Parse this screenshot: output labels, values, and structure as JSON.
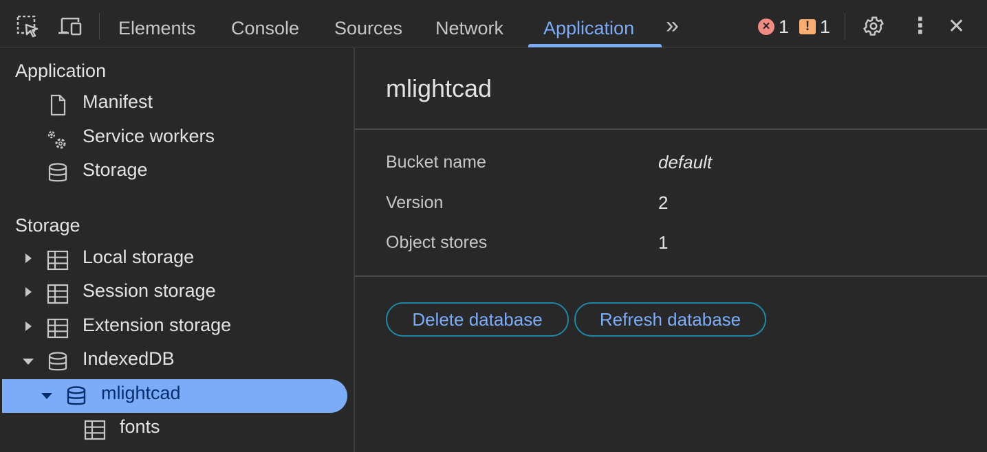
{
  "toolbar": {
    "tabs": [
      "Elements",
      "Console",
      "Sources",
      "Network",
      "Application"
    ],
    "active_tab": "Application",
    "error_count": "1",
    "warning_count": "1",
    "error_icon_glyph": "×",
    "warning_icon_glyph": "!",
    "more_tabs_glyph": "»",
    "close_glyph": "✕",
    "menu_glyph": "⋮"
  },
  "sidebar": {
    "application_section": {
      "title": "Application",
      "items": [
        "Manifest",
        "Service workers",
        "Storage"
      ]
    },
    "storage_section": {
      "title": "Storage",
      "items": [
        "Local storage",
        "Session storage",
        "Extension storage",
        "IndexedDB"
      ],
      "indexeddb_children": {
        "database": "mlightcad",
        "stores": [
          "fonts"
        ]
      }
    }
  },
  "main": {
    "database_name": "mlightcad",
    "details": [
      {
        "key": "Bucket name",
        "value": "default"
      },
      {
        "key": "Version",
        "value": "2"
      },
      {
        "key": "Object stores",
        "value": "1"
      }
    ],
    "buttons": {
      "delete": "Delete database",
      "refresh": "Refresh database"
    }
  },
  "colors": {
    "background": "#282828",
    "accent": "#7cacf8",
    "selection": "#7cacf8",
    "button_border": "#1e88a8",
    "error": "#f28b82",
    "warning": "#fcad70"
  },
  "icons": {
    "inspect": "inspect-element-icon",
    "device": "device-toolbar-icon",
    "settings": "gear-icon",
    "menu": "kebab-menu-icon",
    "close": "close-icon",
    "manifest": "document-icon",
    "service_workers": "gears-icon",
    "storage": "database-icon",
    "table": "table-icon"
  }
}
